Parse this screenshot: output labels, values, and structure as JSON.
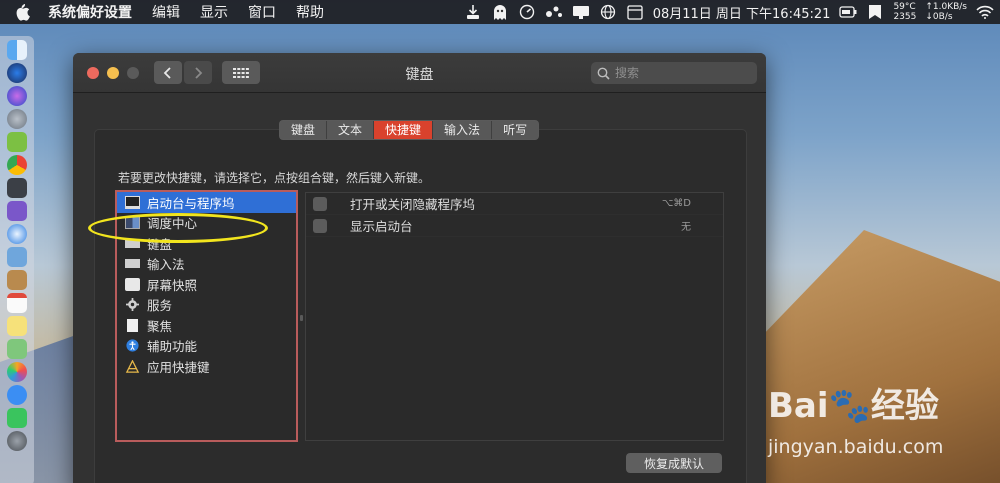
{
  "menubar": {
    "app_name": "系统偏好设置",
    "items": [
      "编辑",
      "显示",
      "窗口",
      "帮助"
    ],
    "clock": "08月11日 周日 下午16:45:21",
    "temp": "59°C",
    "temp_sub": "2355",
    "net_up": "↑1.0KB/s",
    "net_down": "↓0B/s"
  },
  "window": {
    "title": "键盘",
    "search_placeholder": "搜索"
  },
  "tabs": [
    {
      "label": "键盘",
      "active": false
    },
    {
      "label": "文本",
      "active": false
    },
    {
      "label": "快捷键",
      "active": true
    },
    {
      "label": "输入法",
      "active": false
    },
    {
      "label": "听写",
      "active": false
    }
  ],
  "instruction": "若要更改快捷键，请选择它，点按组合键，然后键入新键。",
  "categories": [
    {
      "label": "启动台与程序坞",
      "icon": "launchpad-icon",
      "selected": true
    },
    {
      "label": "调度中心",
      "icon": "mission-control-icon",
      "selected": false
    },
    {
      "label": "键盘",
      "icon": "keyboard-icon",
      "selected": false
    },
    {
      "label": "输入法",
      "icon": "input-method-icon",
      "selected": false
    },
    {
      "label": "屏幕快照",
      "icon": "screenshot-icon",
      "selected": false
    },
    {
      "label": "服务",
      "icon": "services-gear-icon",
      "selected": false
    },
    {
      "label": "聚焦",
      "icon": "spotlight-icon",
      "selected": false
    },
    {
      "label": "辅助功能",
      "icon": "accessibility-icon",
      "selected": false
    },
    {
      "label": "应用快捷键",
      "icon": "app-shortcuts-icon",
      "selected": false
    }
  ],
  "shortcuts": [
    {
      "label": "打开或关闭隐藏程序坞",
      "key": "⌥⌘D",
      "checked": false
    },
    {
      "label": "显示启动台",
      "key": "无",
      "checked": false
    }
  ],
  "restore_button": "恢复成默认",
  "watermark": {
    "logo": "Bai🐾经验",
    "url": "jingyan.baidu.com"
  },
  "colors": {
    "accent_tab": "#d9422d",
    "selection": "#2f6fd6",
    "annotation_ellipse": "#f2e51e",
    "list_border": "#b95c5c"
  }
}
